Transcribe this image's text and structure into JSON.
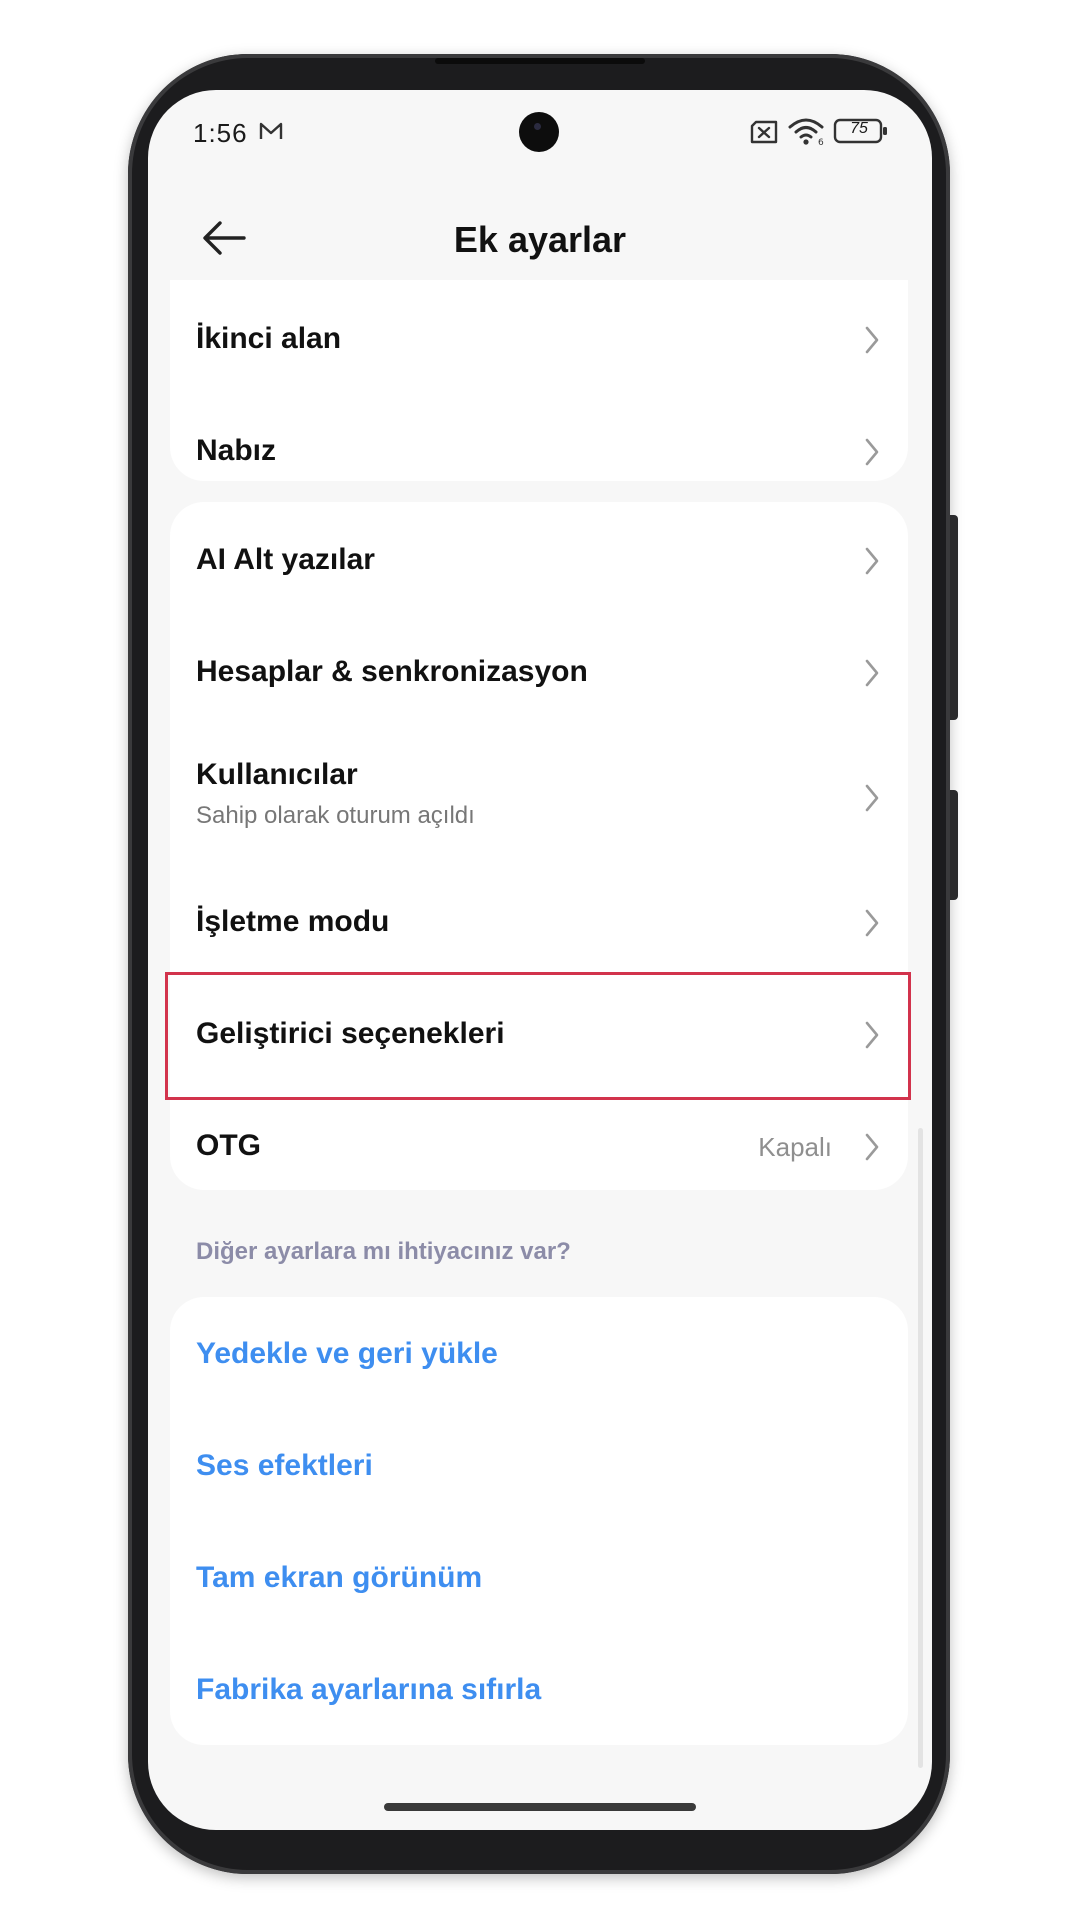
{
  "status_bar": {
    "time": "1:56",
    "battery": "75",
    "icons": [
      "mail-icon",
      "no-sim-icon",
      "wifi-icon",
      "battery-icon"
    ]
  },
  "header": {
    "title": "Ek ayarlar",
    "back_icon": "arrow-left-icon"
  },
  "card1": {
    "items": [
      {
        "title": "İkinci alan"
      },
      {
        "title": "Nabız"
      }
    ]
  },
  "card2": {
    "items": [
      {
        "title": "AI Alt yazılar"
      },
      {
        "title": "Hesaplar & senkronizasyon"
      },
      {
        "title": "Kullanıcılar",
        "subtitle": "Sahip olarak oturum açıldı"
      },
      {
        "title": "İşletme modu"
      },
      {
        "title": "Geliştirici seçenekleri",
        "highlighted": true
      },
      {
        "title": "OTG",
        "value": "Kapalı"
      }
    ]
  },
  "more_settings": {
    "label": "Diğer ayarlara mı ihtiyacınız var?",
    "links": [
      {
        "title": "Yedekle ve geri yükle"
      },
      {
        "title": "Ses efektleri"
      },
      {
        "title": "Tam ekran görünüm"
      },
      {
        "title": "Fabrika ayarlarına sıfırla"
      }
    ]
  },
  "colors": {
    "link": "#3e8ef0",
    "highlight": "#d2334c",
    "background": "#f7f7f7",
    "card": "#ffffff"
  }
}
